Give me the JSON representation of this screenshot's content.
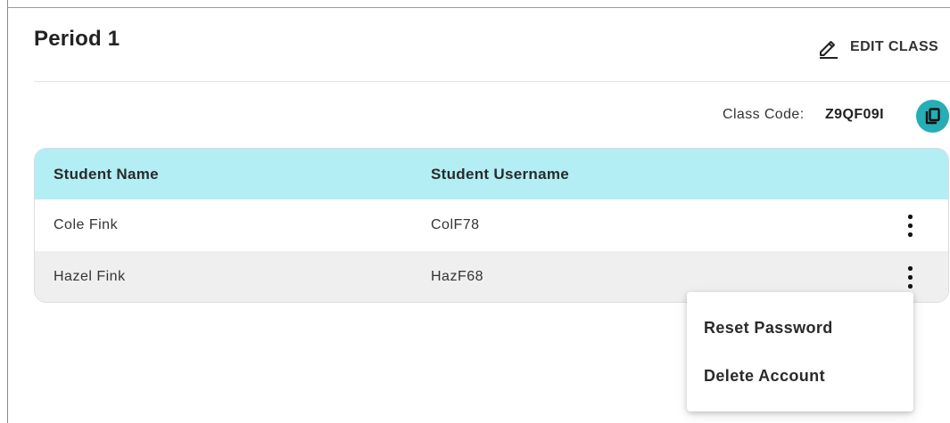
{
  "class": {
    "title": "Period 1",
    "edit_label": "EDIT CLASS",
    "code_label": "Class Code:",
    "code_value": "Z9QF09I"
  },
  "table": {
    "columns": [
      "Student Name",
      "Student Username"
    ],
    "rows": [
      {
        "name": "Cole Fink",
        "username": "ColF78"
      },
      {
        "name": "Hazel Fink",
        "username": "HazF68"
      }
    ]
  },
  "context_menu": {
    "items": [
      "Reset Password",
      "Delete Account"
    ]
  },
  "colors": {
    "header_bg": "#b2eef4",
    "accent": "#26adb6",
    "alt_row": "#efefef"
  },
  "icons": {
    "edit": "pencil-icon",
    "copy": "copy-icon",
    "row_menu": "more-vertical-icon"
  }
}
